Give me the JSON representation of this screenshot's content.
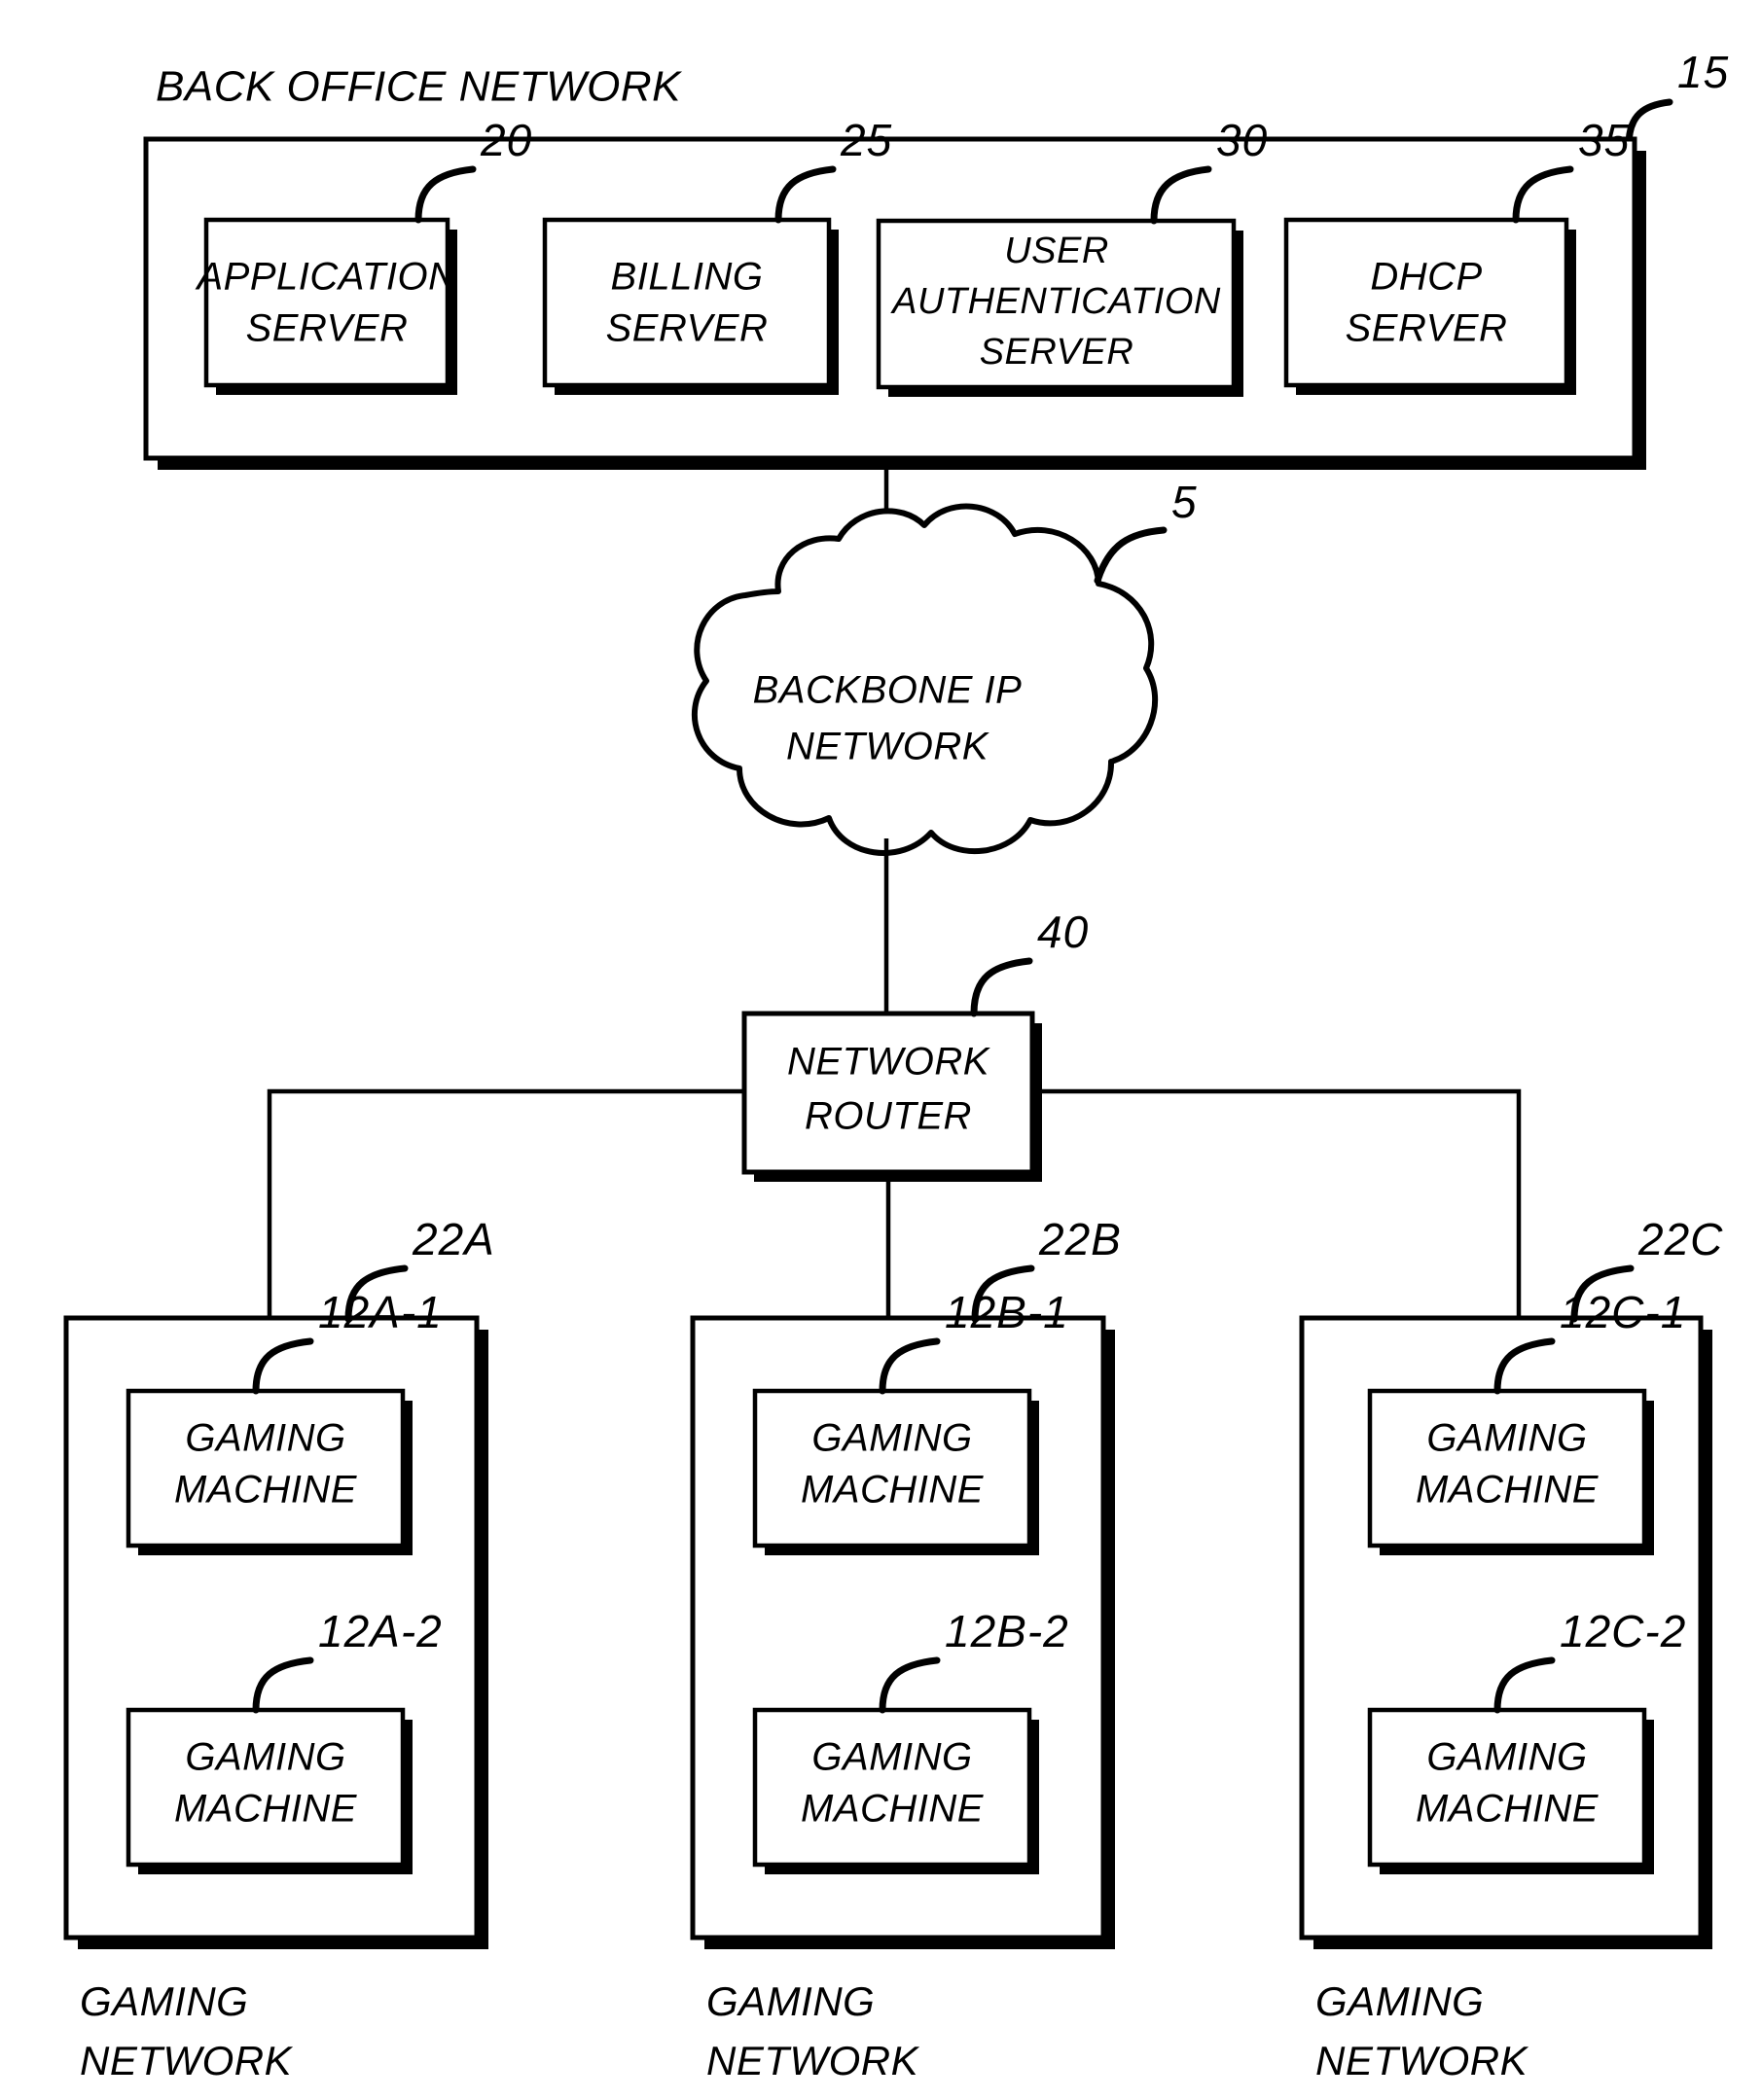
{
  "figure": {
    "title_caption": "BACK OFFICE NETWORK",
    "back_office": {
      "ref": "15",
      "servers": [
        {
          "ref": "20",
          "lines": [
            "APPLICATION",
            "SERVER"
          ]
        },
        {
          "ref": "25",
          "lines": [
            "BILLING",
            "SERVER"
          ]
        },
        {
          "ref": "30",
          "lines": [
            "USER",
            "AUTHENTICATION",
            "SERVER"
          ]
        },
        {
          "ref": "35",
          "lines": [
            "DHCP",
            "SERVER"
          ]
        }
      ]
    },
    "backbone": {
      "ref": "5",
      "lines": [
        "BACKBONE IP",
        "NETWORK"
      ]
    },
    "router": {
      "ref": "40",
      "lines": [
        "NETWORK",
        "ROUTER"
      ]
    },
    "gaming_networks": [
      {
        "ref": "22A",
        "caption_lines": [
          "GAMING",
          "NETWORK"
        ],
        "machines": [
          {
            "ref": "12A-1",
            "lines": [
              "GAMING",
              "MACHINE"
            ]
          },
          {
            "ref": "12A-2",
            "lines": [
              "GAMING",
              "MACHINE"
            ]
          }
        ]
      },
      {
        "ref": "22B",
        "caption_lines": [
          "GAMING",
          "NETWORK"
        ],
        "machines": [
          {
            "ref": "12B-1",
            "lines": [
              "GAMING",
              "MACHINE"
            ]
          },
          {
            "ref": "12B-2",
            "lines": [
              "GAMING",
              "MACHINE"
            ]
          }
        ]
      },
      {
        "ref": "22C",
        "caption_lines": [
          "GAMING",
          "NETWORK"
        ],
        "machines": [
          {
            "ref": "12C-1",
            "lines": [
              "GAMING",
              "MACHINE"
            ]
          },
          {
            "ref": "12C-2",
            "lines": [
              "GAMING",
              "MACHINE"
            ]
          }
        ]
      }
    ],
    "colors": {
      "ink": "#000000",
      "paper": "#ffffff"
    }
  }
}
